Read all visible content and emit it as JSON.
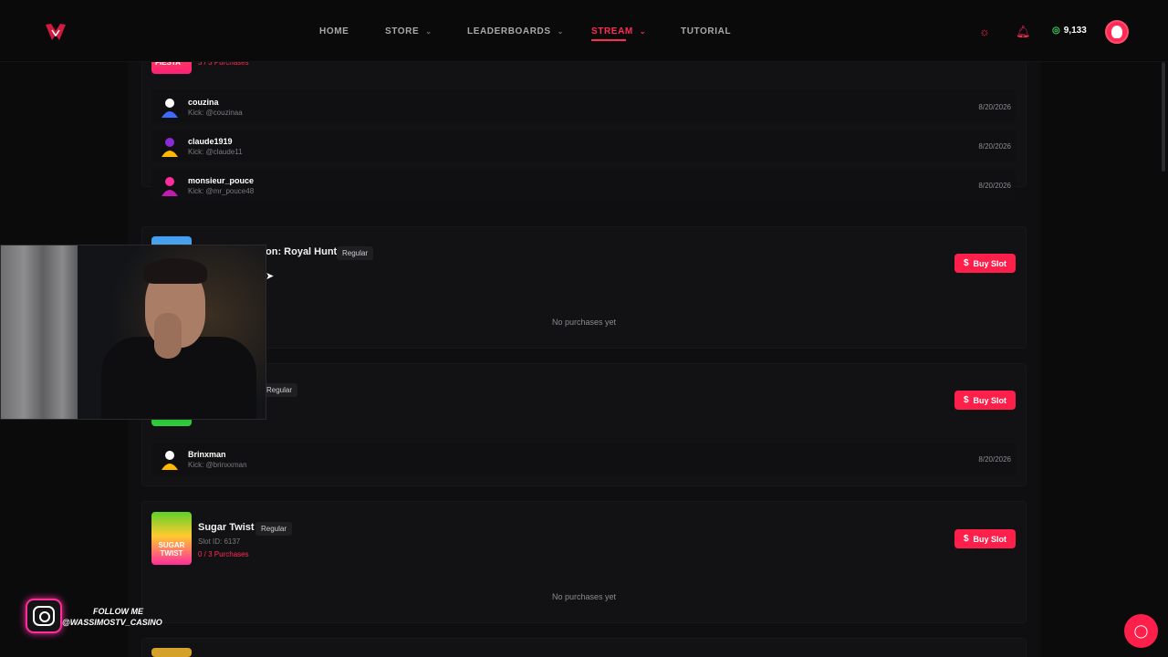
{
  "nav": {
    "items": [
      {
        "label": "HOME",
        "dropdown": false,
        "active": false
      },
      {
        "label": "STORE",
        "dropdown": true,
        "active": false
      },
      {
        "label": "LEADERBOARDS",
        "dropdown": true,
        "active": false
      },
      {
        "label": "STREAM",
        "dropdown": true,
        "active": true
      },
      {
        "label": "TUTORIAL",
        "dropdown": false,
        "active": false
      }
    ],
    "coins": "9,133",
    "icons": [
      "brand-logo-icon",
      "sun-icon",
      "bell-icon",
      "coin-icon",
      "user-avatar-icon"
    ]
  },
  "slots": [
    {
      "thumb_text": "FIESTA",
      "title": "",
      "badge": "",
      "slot_id": "",
      "purchases": "3 / 3 Purchases",
      "buyers": [
        {
          "name": "couzina",
          "handle": "Kick: @couzinaa",
          "date": "8/20/2026"
        },
        {
          "name": "claude1919",
          "handle": "Kick: @claude11",
          "date": "8/20/2026"
        },
        {
          "name": "monsieur_pouce",
          "handle": "Kick: @mr_pouce48",
          "date": "8/20/2026"
        }
      ]
    },
    {
      "title": "on: Royal Hunt",
      "badge": "Regular",
      "buy_label": "Buy Slot",
      "empty_text": "No purchases yet"
    },
    {
      "badge": "Regular",
      "buy_label": "Buy Slot",
      "buyers": [
        {
          "name": "Brinxman",
          "handle": "Kick: @brinxxman",
          "date": "8/20/2026"
        }
      ]
    },
    {
      "thumb_text": "SUGAR TWIST",
      "title": "Sugar Twist",
      "badge": "Regular",
      "slot_id": "Slot ID: 6137",
      "purchases": "0 / 3 Purchases",
      "buy_label": "Buy Slot",
      "empty_text": "No purchases yet"
    }
  ],
  "overlay": {
    "follow_line1": "FOLLOW ME",
    "follow_line2": "@WASSIMOSTV_CASINO"
  },
  "colors": {
    "accent": "#ff1f4b",
    "background": "#0b0b0c",
    "coin": "#3ed15a",
    "instagram": "#ff2d9c"
  }
}
